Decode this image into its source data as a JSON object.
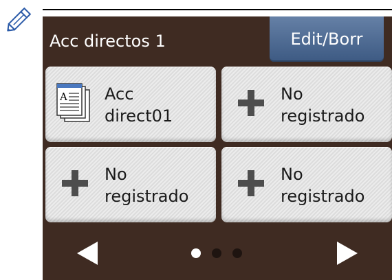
{
  "header": {
    "title": "Acc directos 1",
    "edit_label": "Edit/Borr"
  },
  "tiles": [
    {
      "line1": "Acc",
      "line2": "direct01",
      "icon": "document-icon"
    },
    {
      "line1": "No",
      "line2": "registrado",
      "icon": "plus-icon"
    },
    {
      "line1": "No",
      "line2": "registrado",
      "icon": "plus-icon"
    },
    {
      "line1": "No",
      "line2": "registrado",
      "icon": "plus-icon"
    }
  ],
  "pagination": {
    "total_pages": 3,
    "current_page": 1
  },
  "colors": {
    "screen_background": "#3f2b22",
    "edit_button": "#4f6b93",
    "tile_background": "#e3e3e3",
    "dot_active": "#ffffff",
    "dot_inactive": "#1e1410"
  },
  "icons": {
    "corner": "pencil-icon",
    "nav_previous": "arrow-left-icon",
    "nav_next": "arrow-right-icon"
  }
}
